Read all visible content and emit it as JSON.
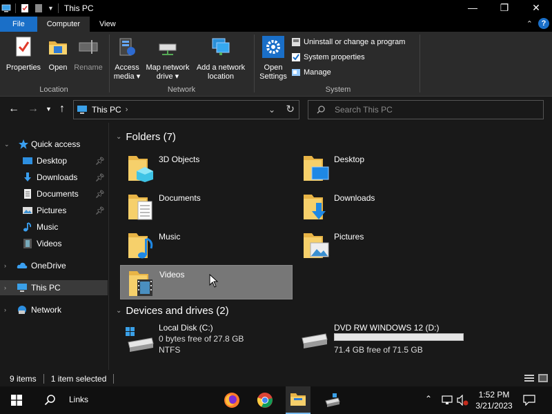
{
  "window": {
    "title": "This PC"
  },
  "tabs": {
    "file": "File",
    "computer": "Computer",
    "view": "View"
  },
  "ribbon": {
    "location": {
      "label": "Location",
      "properties": "Properties",
      "open": "Open",
      "rename": "Rename"
    },
    "network": {
      "label": "Network",
      "access_media_1": "Access",
      "access_media_2": "media",
      "map_drive_1": "Map network",
      "map_drive_2": "drive",
      "add_location_1": "Add a network",
      "add_location_2": "location"
    },
    "system": {
      "label": "System",
      "open_settings_1": "Open",
      "open_settings_2": "Settings",
      "uninstall": "Uninstall or change a program",
      "system_properties": "System properties",
      "manage": "Manage"
    }
  },
  "address": {
    "path": "This PC",
    "search_placeholder": "Search This PC"
  },
  "nav": {
    "quick_access": "Quick access",
    "desktop": "Desktop",
    "downloads": "Downloads",
    "documents": "Documents",
    "pictures": "Pictures",
    "music": "Music",
    "videos": "Videos",
    "onedrive": "OneDrive",
    "this_pc": "This PC",
    "network": "Network"
  },
  "content": {
    "folders_header": "Folders (7)",
    "folders": [
      "3D Objects",
      "Desktop",
      "Documents",
      "Downloads",
      "Music",
      "Pictures",
      "Videos"
    ],
    "drives_header": "Devices and drives (2)",
    "drives": [
      {
        "name": "Local Disk (C:)",
        "space": "0 bytes free of 27.8 GB",
        "fs": "NTFS"
      },
      {
        "name": "DVD RW WINDOWS 12 (D:)",
        "space": "71.4 GB free of 71.5 GB",
        "used_fraction": 0.0
      }
    ]
  },
  "status": {
    "items": "9 items",
    "selected": "1 item selected"
  },
  "taskbar": {
    "links": "Links",
    "time": "1:52 PM",
    "date": "3/21/2023"
  },
  "colors": {
    "accent": "#1a6fc8",
    "folder": "#f2c75c",
    "selection": "#777777"
  }
}
